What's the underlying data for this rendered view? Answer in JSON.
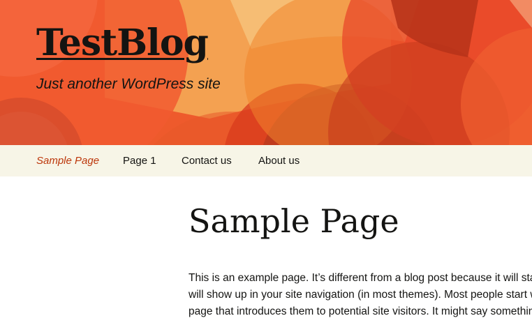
{
  "site": {
    "title": "TestBlog",
    "tagline": "Just another WordPress site"
  },
  "nav": {
    "items": [
      {
        "label": "Sample Page",
        "current": true
      },
      {
        "label": "Page 1",
        "current": false
      },
      {
        "label": "Contact us",
        "current": false
      },
      {
        "label": "About us",
        "current": false
      }
    ]
  },
  "page": {
    "title": "Sample Page",
    "lines": [
      "This is an example page. It’s different from a blog post because it will stay i",
      "will show up in your site navigation (in most themes). Most people start wi",
      "page that introduces them to potential site visitors. It might say something"
    ]
  },
  "colors": {
    "header_background": "#ee5a2c",
    "navbar_background": "#f7f5e7",
    "current_nav_link": "#bc360a",
    "text": "#141412"
  }
}
